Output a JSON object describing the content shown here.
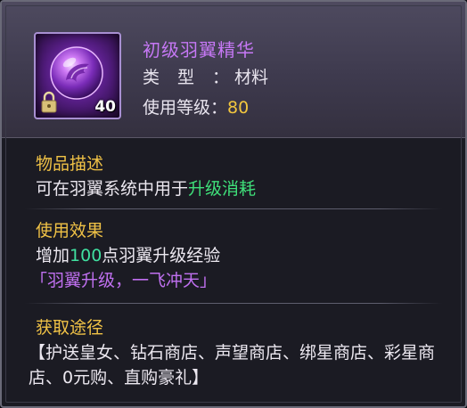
{
  "item": {
    "name": "初级羽翼精华",
    "type_label": "类型：",
    "type_value": "材料",
    "level_label": "使用等级：",
    "level_value": "80",
    "stack_count": "40",
    "icon": "purple-wing-orb-icon",
    "locked": true
  },
  "description": {
    "title": "物品描述",
    "text_prefix": "可在羽翼系统中用于",
    "text_highlight": "升级消耗"
  },
  "effect": {
    "title": "使用效果",
    "text_prefix": "增加",
    "amount": "100",
    "text_suffix": "点羽翼升级经验",
    "slogan": "「羽翼升级，一飞冲天」"
  },
  "source": {
    "title": "获取途径",
    "text": "【护送皇女、钻石商店、声望商店、绑星商店、彩星商店、0元购、直购豪礼】"
  },
  "colors": {
    "name": "#c678f5",
    "section_title": "#f0c246",
    "highlight_green": "#3fe07a",
    "slogan_purple": "#c070f0",
    "level_value": "#f2c63e",
    "background": "#1b1b23"
  }
}
